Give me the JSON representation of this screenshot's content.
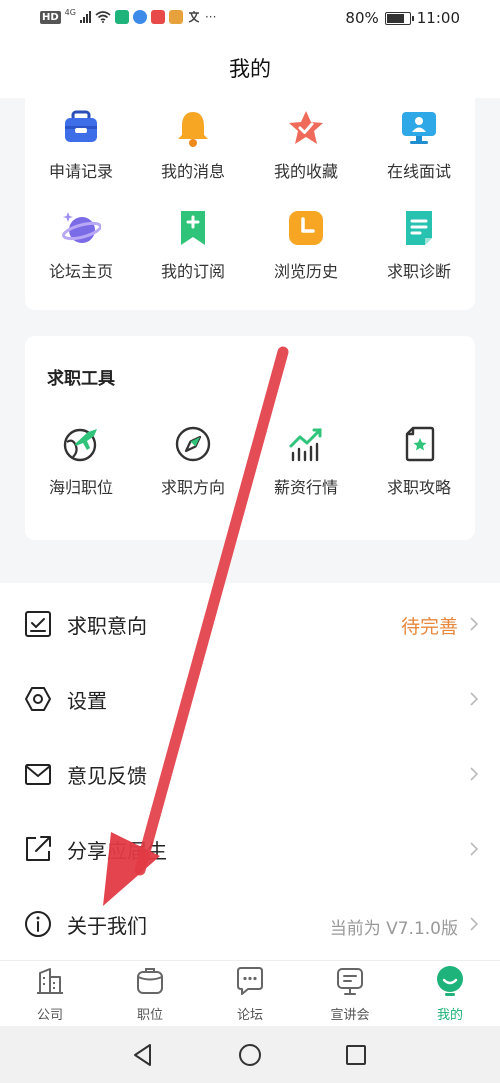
{
  "status_bar": {
    "hd": "HD",
    "net": "4G",
    "battery": "80%",
    "battery_level": 0.8,
    "time": "11:00",
    "dots": "···"
  },
  "title": "我的",
  "shortcuts": [
    {
      "label": "申请记录",
      "icon": "briefcase-icon",
      "color": "#3d6ee8"
    },
    {
      "label": "我的消息",
      "icon": "bell-icon",
      "color": "#f6a623"
    },
    {
      "label": "我的收藏",
      "icon": "star-icon",
      "color": "#f06a5a"
    },
    {
      "label": "在线面试",
      "icon": "monitor-icon",
      "color": "#2fa8e8"
    },
    {
      "label": "论坛主页",
      "icon": "planet-icon",
      "color": "#7c6be6"
    },
    {
      "label": "我的订阅",
      "icon": "bookmark-icon",
      "color": "#2fc47a"
    },
    {
      "label": "浏览历史",
      "icon": "clock-icon",
      "color": "#f6a623"
    },
    {
      "label": "求职诊断",
      "icon": "document-icon",
      "color": "#27c2b0"
    }
  ],
  "tools": {
    "title": "求职工具",
    "items": [
      {
        "label": "海归职位",
        "icon": "globe-plane-icon"
      },
      {
        "label": "求职方向",
        "icon": "compass-icon"
      },
      {
        "label": "薪资行情",
        "icon": "trend-chart-icon"
      },
      {
        "label": "求职攻略",
        "icon": "guide-book-icon"
      }
    ]
  },
  "menu": [
    {
      "label": "求职意向",
      "value": "待完善",
      "icon": "checklist-icon"
    },
    {
      "label": "设置",
      "value": "",
      "icon": "hexagon-settings-icon"
    },
    {
      "label": "意见反馈",
      "value": "",
      "icon": "mail-icon"
    },
    {
      "label": "分享应届生",
      "value": "",
      "icon": "share-icon"
    },
    {
      "label": "关于我们",
      "value": "当前为 V7.1.0版",
      "icon": "info-icon"
    }
  ],
  "bottom_nav": [
    {
      "label": "公司",
      "icon": "building-icon"
    },
    {
      "label": "职位",
      "icon": "bag-icon"
    },
    {
      "label": "论坛",
      "icon": "chat-icon"
    },
    {
      "label": "宣讲会",
      "icon": "presentation-icon"
    },
    {
      "label": "我的",
      "icon": "profile-icon",
      "active": true
    }
  ],
  "colors": {
    "accent": "#1db37a",
    "warning": "#e8883f",
    "arrow": "#e23a44"
  }
}
